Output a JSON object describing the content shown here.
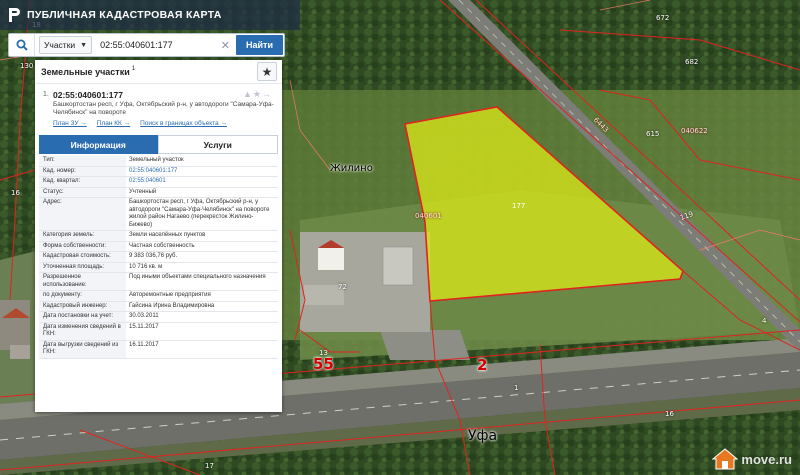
{
  "header": {
    "title": "ПУБЛИЧНАЯ КАДАСТРОВАЯ КАРТА"
  },
  "search": {
    "type_selected": "Участки",
    "query": "02:55:040601:177",
    "find_label": "Найти"
  },
  "panel": {
    "title": "Земельные участки",
    "count": "1",
    "result": {
      "num": "1.",
      "id": "02:55:040601:177",
      "address": "Башкортостан респ, г Уфа, Октябрьский р-н, у автодороги \"Самара-Уфа-Челябинск\" на повороте",
      "links": [
        "План ЗУ →",
        "План КК →",
        "Поиск в границах объекта →"
      ]
    },
    "tabs": [
      "Информация",
      "Услуги"
    ],
    "rows": [
      {
        "key": "Тип:",
        "value": "Земельный участок"
      },
      {
        "key": "Кад. номер:",
        "value": "02:55:040601:177"
      },
      {
        "key": "Кад. квартал:",
        "value": "02:55:040601"
      },
      {
        "key": "Статус:",
        "value": "Учтенный"
      },
      {
        "key": "Адрес:",
        "value": "Башкортостан респ, г Уфа, Октябрьский р-н, у автодороги \"Самара-Уфа-Челябинск\" на повороте жилой район Нагаево (перекресток Жилино-Бижево)"
      },
      {
        "key": "Категория земель:",
        "value": "Земли населённых пунктов"
      },
      {
        "key": "Форма собственности:",
        "value": "Частная собственность"
      },
      {
        "key": "Кадастровая стоимость:",
        "value": "9 383 036,76 руб."
      },
      {
        "key": "Уточненная площадь:",
        "value": "10 716 кв. м"
      },
      {
        "key": "Разрешенное использование:",
        "value": "Под иными объектами специального назначения"
      },
      {
        "key": "по документу:",
        "value": "Авторемонтные предприятия"
      },
      {
        "key": "Кадастровый инженер:",
        "value": "Гайсина Ирина Владимировна"
      },
      {
        "key": "Дата постановки на учет:",
        "value": "30.03.2011"
      },
      {
        "key": "Дата изменения сведений в ГКН:",
        "value": "15.11.2017"
      },
      {
        "key": "Дата выгрузки сведений из ГКН:",
        "value": "16.11.2017"
      }
    ]
  },
  "map": {
    "labels": {
      "village": "Жилино",
      "city": "Уфа",
      "road_number": "2",
      "road_number_55": "55",
      "parcel_177": "177",
      "q_040601": "040601",
      "q_040622": "040622",
      "n_672": "672",
      "n_682": "682",
      "n_615": "615",
      "n_72": "72",
      "n_130": "130",
      "n_16a": "16",
      "n_16b": "16",
      "n_13": "13",
      "n_1": "1",
      "n_4": "4",
      "n_17": "17",
      "n_8": "8",
      "n_18": "18",
      "n_6443": "6443",
      "n_119": "119"
    }
  },
  "watermark": {
    "text": "move.ru"
  },
  "colors": {
    "header_bg": "#1e2d46",
    "accent": "#2a6cb0",
    "parcel_fill": "#d7e61a",
    "boundary": "#e0231f"
  }
}
